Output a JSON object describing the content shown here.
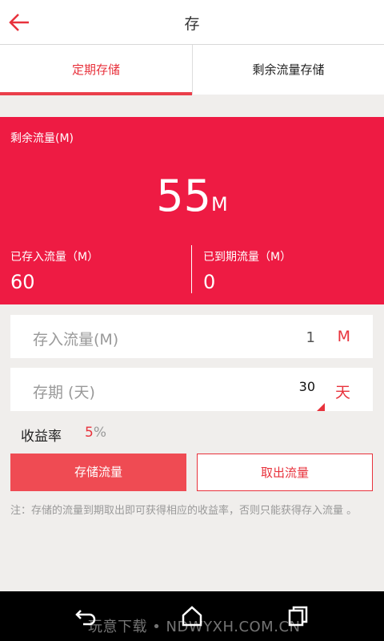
{
  "header": {
    "title": "存",
    "back_icon": "arrow-left-icon"
  },
  "tabs": [
    {
      "label": "定期存储",
      "active": true
    },
    {
      "label": "剩余流量存储",
      "active": false
    }
  ],
  "hero": {
    "label": "剩余流量(M)",
    "value": "55",
    "unit": "M",
    "stored_label": "已存入流量（M）",
    "stored_value": "60",
    "expired_label": "已到期流量（M）",
    "expired_value": "0"
  },
  "form": {
    "deposit_label": "存入流量(M)",
    "deposit_value": "1",
    "deposit_unit": "M",
    "term_label": "存期 (天)",
    "term_value": "30",
    "term_unit": "天"
  },
  "rate": {
    "label": "收益率",
    "value": "5",
    "unit": "%"
  },
  "buttons": {
    "save": "存储流量",
    "withdraw": "取出流量"
  },
  "note": "注：存储的流量到期取出即可获得相应的收益率，否则只能获得存入流量 。",
  "colors": {
    "accent": "#ee1b43",
    "accent_text": "#e8323c"
  },
  "navbar": {
    "watermark": "玩意下载 • NDWYXH.COM.CN"
  }
}
